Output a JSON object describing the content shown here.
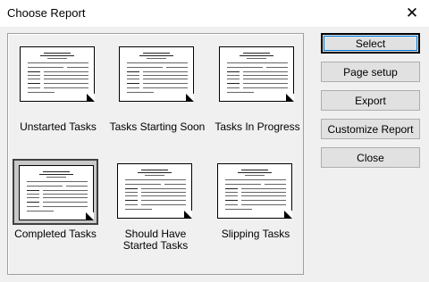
{
  "window": {
    "title": "Choose Report"
  },
  "reports": [
    {
      "label": "Unstarted Tasks",
      "selected": false
    },
    {
      "label": "Tasks Starting Soon",
      "selected": false
    },
    {
      "label": "Tasks In Progress",
      "selected": false
    },
    {
      "label": "Completed Tasks",
      "selected": true
    },
    {
      "label": "Should Have\nStarted Tasks",
      "selected": false
    },
    {
      "label": "Slipping Tasks",
      "selected": false
    }
  ],
  "buttons": {
    "select": "Select",
    "page_setup": "Page setup",
    "export": "Export",
    "customize_report": "Customize Report",
    "close": "Close"
  },
  "icons": {
    "close": "close-icon",
    "report": "report-document-icon"
  },
  "colors": {
    "selected_bg": "#c8c8c8",
    "focus_border": "#0078d7"
  }
}
